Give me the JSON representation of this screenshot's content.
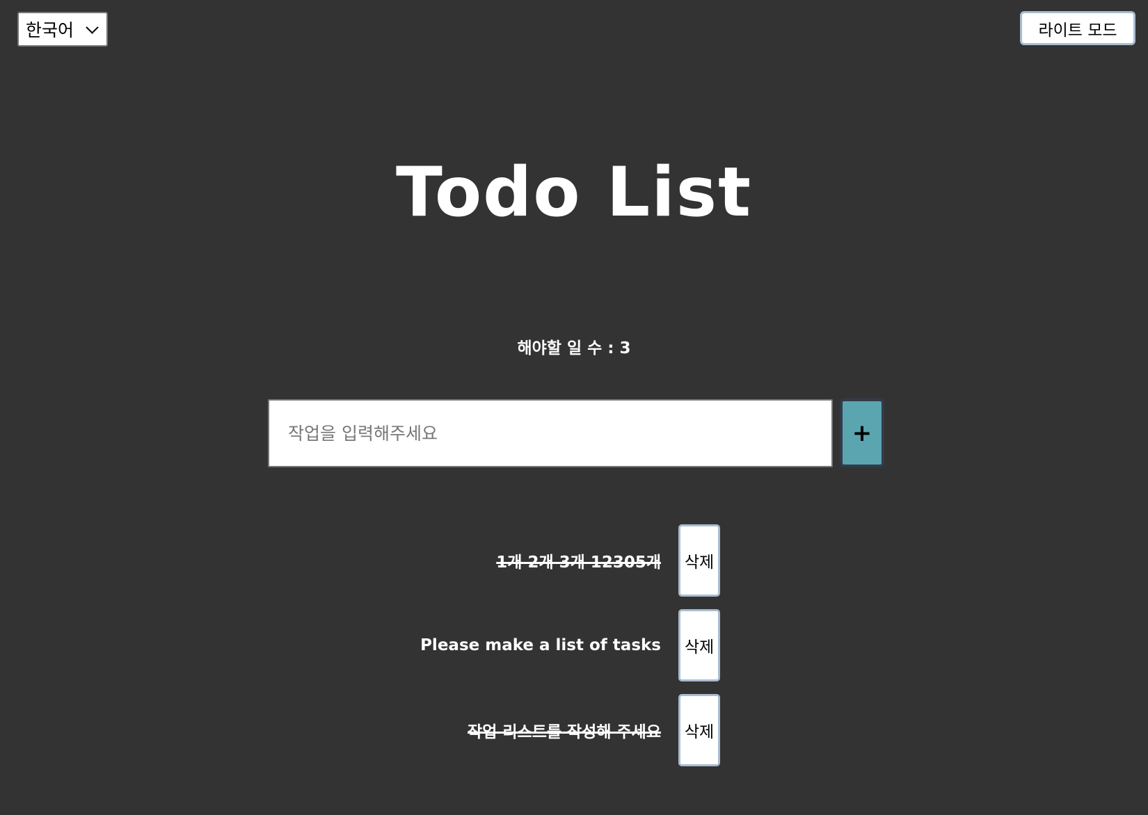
{
  "language_select": {
    "value": "한국어",
    "icon": "chevron-down-icon"
  },
  "theme_toggle": {
    "label": "라이트 모드"
  },
  "title": "Todo List",
  "count": {
    "text": "해야할 일 수 : 3"
  },
  "input": {
    "placeholder": "작업을 입력해주세요",
    "value": ""
  },
  "add_button": {
    "label": "+",
    "color": "#5aa5b0"
  },
  "todos": [
    {
      "text": "1개 2개 3개 12305개",
      "completed": true,
      "delete_label": "삭제"
    },
    {
      "text": "Please make a list of tasks",
      "completed": false,
      "delete_label": "삭제"
    },
    {
      "text": "작업 리스트를 작성해 주세요",
      "completed": true,
      "delete_label": "삭제"
    }
  ],
  "colors": {
    "background": "#333333",
    "button_border": "#a9bcd0"
  }
}
